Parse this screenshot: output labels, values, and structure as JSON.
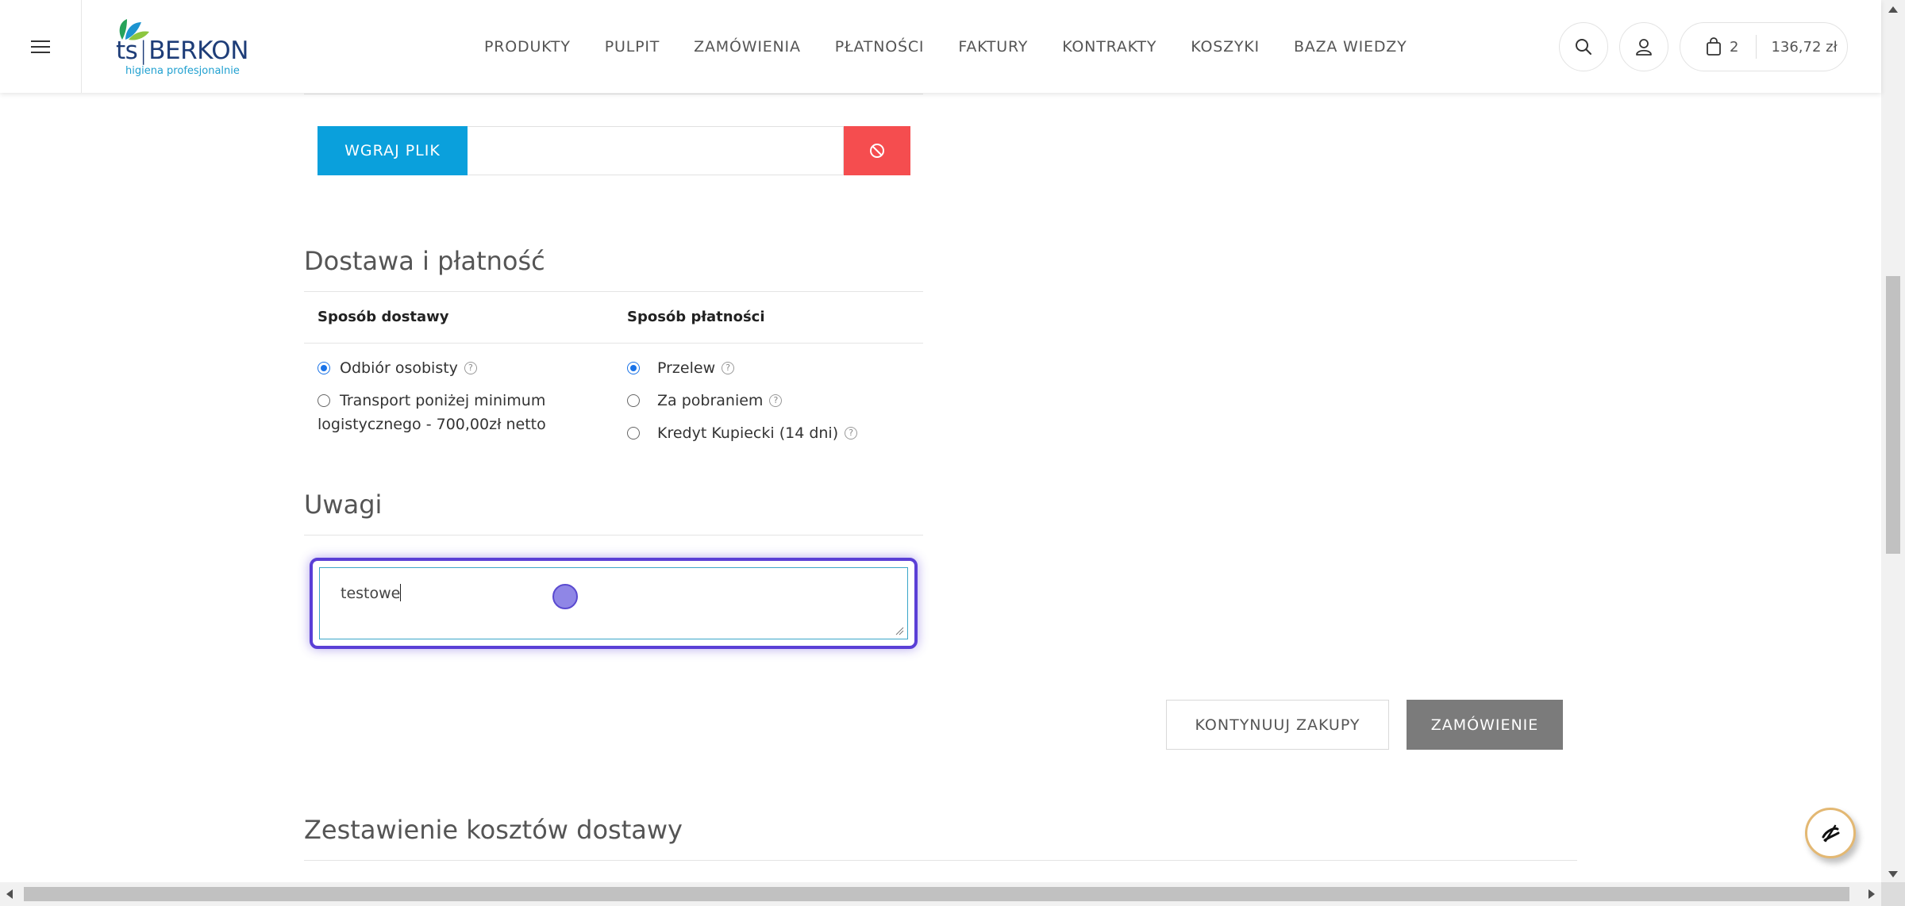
{
  "header": {
    "logo": {
      "brand_left": "ts",
      "brand_right": "BERKON",
      "tagline": "higiena profesjonalnie"
    },
    "nav": [
      "PRODUKTY",
      "PULPIT",
      "ZAMÓWIENIA",
      "PŁATNOŚCI",
      "FAKTURY",
      "KONTRAKTY",
      "KOSZYKI",
      "BAZA WIEDZY"
    ],
    "search_icon": "search-icon",
    "user_icon": "user-icon",
    "cart": {
      "icon": "shopping-bag-icon",
      "count": "2",
      "total": "136,72 zł"
    }
  },
  "upload": {
    "button_label": "WGRAJ PLIK",
    "file_value": "",
    "clear_icon": "block-icon"
  },
  "delivery_payment": {
    "title": "Dostawa i płatność",
    "delivery": {
      "heading": "Sposób dostawy",
      "options": [
        {
          "label": "Odbiór osobisty",
          "checked": true,
          "help": true
        },
        {
          "label": "Transport poniżej minimum",
          "label_line2": "logistycznego - 700,00zł netto",
          "checked": false,
          "help": false
        }
      ]
    },
    "payment": {
      "heading": "Sposób płatności",
      "options": [
        {
          "label": "Przelew",
          "checked": true,
          "help": true
        },
        {
          "label": "Za pobraniem",
          "checked": false,
          "help": true
        },
        {
          "label": "Kredyt Kupiecki (14 dni)",
          "checked": false,
          "help": true
        }
      ]
    }
  },
  "notes": {
    "title": "Uwagi",
    "value": "testowe"
  },
  "actions": {
    "continue_label": "KONTYNUUJ ZAKUPY",
    "order_label": "ZAMÓWIENIE"
  },
  "shipping_summary": {
    "title": "Zestawienie kosztów dostawy"
  },
  "colors": {
    "upload_blue": "#0aa0dc",
    "clear_red": "#f54d4f",
    "order_gray": "#7b7b7b",
    "focus_purple": "#5a3fd6"
  }
}
